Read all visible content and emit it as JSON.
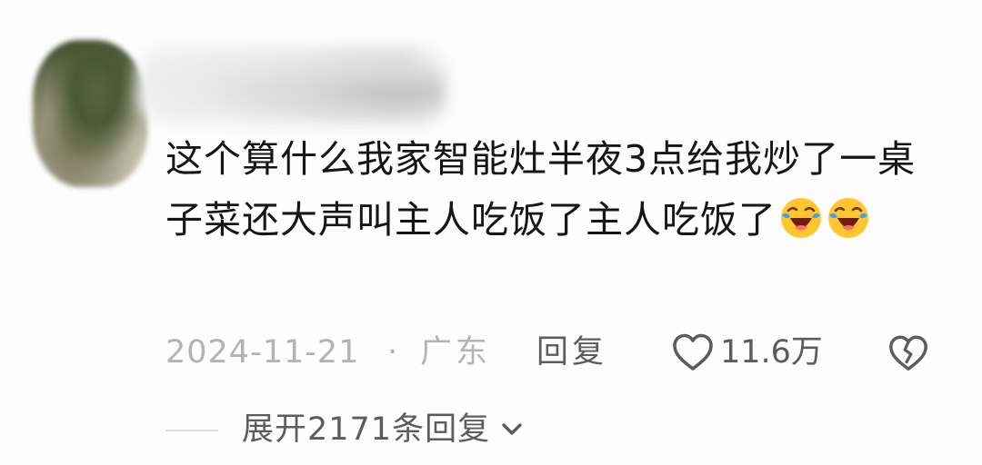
{
  "comment": {
    "text": "这个算什么我家智能灶半夜3点给我炒了一桌子菜还大声叫主人吃饭了主人吃饭了",
    "date": "2024-11-21",
    "separator": "·",
    "location": "广东",
    "reply_label": "回复",
    "like_count": "11.6万",
    "expand_replies_label": "展开2171条回复"
  },
  "icons": {
    "emoji": "crying-laughing-emoji",
    "like": "heart-outline-icon",
    "dislike": "broken-heart-icon",
    "expand": "chevron-down-icon"
  },
  "colors": {
    "text_primary": "#161616",
    "text_secondary": "#5c5c5c",
    "text_muted": "#b3b3b3",
    "emoji_face": "#ffc62e",
    "emoji_tears": "#3aa3f5"
  }
}
